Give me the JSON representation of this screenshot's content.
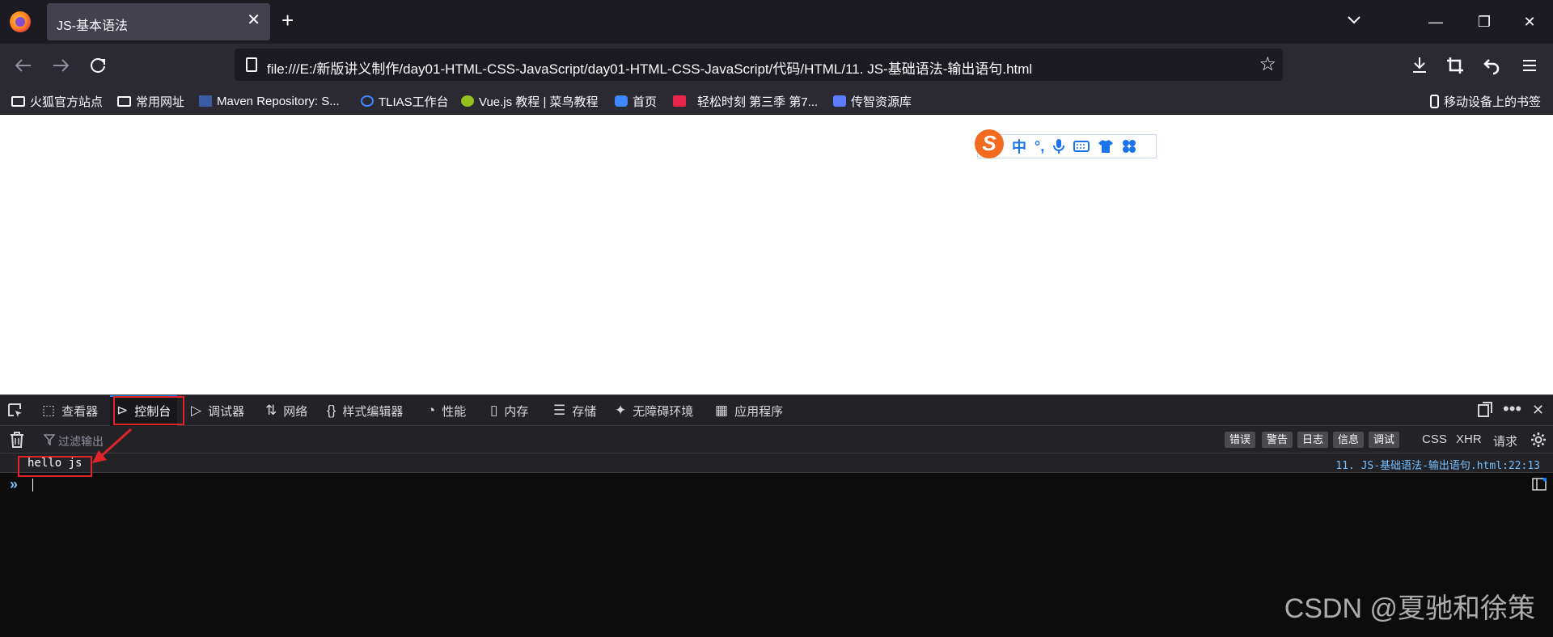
{
  "tab": {
    "title": "JS-基本语法",
    "close": "✕"
  },
  "new_tab": "+",
  "window": {
    "minimize": "—",
    "restore": "❐",
    "close": "✕"
  },
  "url": "file:///E:/新版讲义制作/day01-HTML-CSS-JavaScript/day01-HTML-CSS-JavaScript/代码/HTML/11. JS-基础语法-输出语句.html",
  "bookmarks": [
    {
      "label": "火狐官方站点",
      "icon": "folder-icon"
    },
    {
      "label": "常用网址",
      "icon": "folder-icon"
    },
    {
      "label": "Maven Repository: S...",
      "icon": "maven-icon"
    },
    {
      "label": "TLIAS工作台",
      "icon": "tlias-icon"
    },
    {
      "label": "Vue.js 教程 | 菜鸟教程",
      "icon": "runoob-icon"
    },
    {
      "label": "首页",
      "icon": "bilibili-icon"
    },
    {
      "label": "轻松时刻 第三季 第7...",
      "icon": "tv-icon"
    },
    {
      "label": "传智资源库",
      "icon": "db-icon"
    }
  ],
  "mobile_bookmarks": "移动设备上的书签",
  "ime": {
    "logo": "S",
    "lang": "中",
    "punct": "°,"
  },
  "devtools": {
    "tabs": [
      {
        "label": "查看器",
        "glyph": "⬚"
      },
      {
        "label": "控制台",
        "glyph": "⊳"
      },
      {
        "label": "调试器",
        "glyph": "▷"
      },
      {
        "label": "网络",
        "glyph": "⇅"
      },
      {
        "label": "样式编辑器",
        "glyph": "{}"
      },
      {
        "label": "性能",
        "glyph": "◔"
      },
      {
        "label": "内存",
        "glyph": "▯"
      },
      {
        "label": "存储",
        "glyph": "☰"
      },
      {
        "label": "无障碍环境",
        "glyph": "✦"
      },
      {
        "label": "应用程序",
        "glyph": "▦"
      }
    ],
    "filter_placeholder": "过滤输出",
    "levels": [
      "错误",
      "警告",
      "日志",
      "信息",
      "调试"
    ],
    "filters": [
      "CSS",
      "XHR",
      "请求"
    ],
    "log": {
      "message": "hello js",
      "source": "11. JS-基础语法-输出语句.html:22:13"
    },
    "prompt": "»"
  },
  "watermark": "CSDN @夏驰和徐策"
}
